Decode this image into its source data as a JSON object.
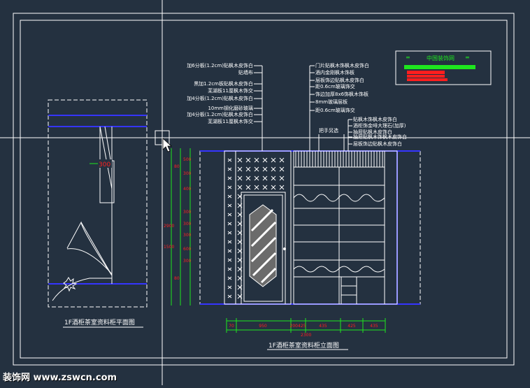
{
  "logo": {
    "text": "中国装饰网",
    "bar_color": "#1ee61e",
    "alert_color": "#ff1e1e"
  },
  "plan_title": "1F酒柜茶室资料柜平面图",
  "elevation_title": "1F酒柜茶室资料柜立面图",
  "plan_dim": "300",
  "left_labels": [
    "加6分板(1.2cm)贴枫木皮饰白",
    "贴墙布",
    "黑加1.2cm板贴枫木皮饰白",
    "芜湖板11厘枫木饰交",
    "加4分板(1.2cm)贴枫木皮饰白",
    "10mm钢化磨砂玻璃",
    "加4分板(1.2cm)贴枫木皮饰白",
    "芜湖板11厘枫木饰交"
  ],
  "right_labels_top": [
    "门片贴枫木饰枫木皮饰白",
    "酒内金刚枫木饰板",
    "层板饰边贴枫木皮饰白",
    "距0.6cm玻璃饰交",
    "饰边加厚8x6饰枫木饰板",
    "8mm玻璃层板",
    "距0.6cm玻璃饰交"
  ],
  "right_labels_bottom": [
    "贴枫木饰枫木皮饰白",
    "酒柜饰金啡大理石(加厚)",
    "抽屉贴枫木皮饰白",
    "抽屉贴枫木饰枫木皮饰白",
    "层板饰边贴枫木皮饰白"
  ],
  "handle_label": "把手另选",
  "vertical_dims": [
    "500",
    "80",
    "300",
    "400",
    "300",
    "300",
    "300",
    "600",
    "300",
    "80",
    "2900",
    "1500"
  ],
  "horizontal_dims": [
    "70",
    "950",
    "200425",
    "435",
    "425",
    "435"
  ],
  "horizontal_total": "2300",
  "watermark": "装饰网 www.zswcn.com"
}
